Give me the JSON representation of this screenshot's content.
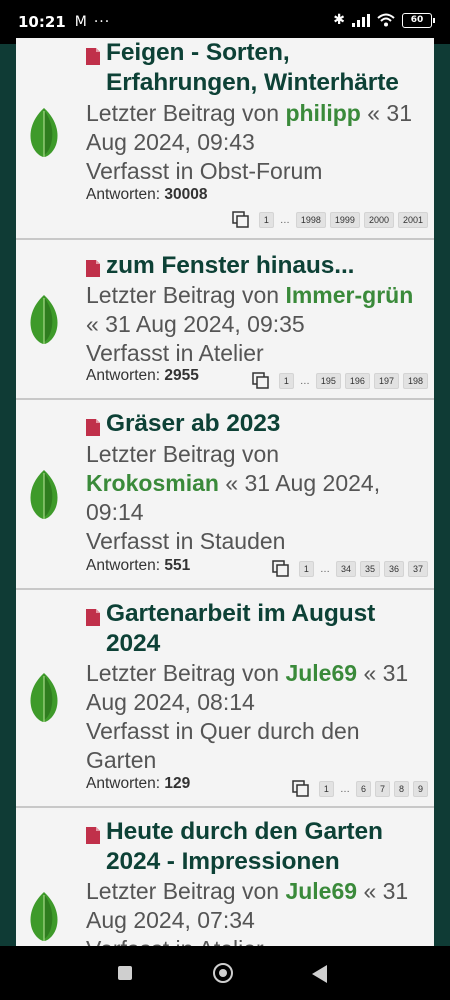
{
  "status": {
    "time": "10:21",
    "battery": "60"
  },
  "topics": [
    {
      "title_lines": [
        "Feigen - Sorten,",
        "Erfahrungen, Winterhärte"
      ],
      "last_prefix": "Letzter Beitrag von",
      "author": "philipp",
      "date_parts": [
        "« 31",
        "Aug 2024, 09:43"
      ],
      "forum_prefix": "Verfasst in",
      "forum_lines": [
        "Obst-Forum"
      ],
      "replies_label": "Antworten:",
      "replies": "30008",
      "pages": [
        "1",
        "1998",
        "1999",
        "2000",
        "2001"
      ]
    },
    {
      "title_lines": [
        "zum Fenster hinaus..."
      ],
      "last_prefix": "Letzter Beitrag von",
      "author": "Immer-grün",
      "date_parts": [
        "« 31 Aug 2024, 09:35"
      ],
      "forum_prefix": "Verfasst in",
      "forum_lines": [
        "Atelier"
      ],
      "replies_label": "Antworten:",
      "replies": "2955",
      "pages": [
        "1",
        "195",
        "196",
        "197",
        "198"
      ]
    },
    {
      "title_lines": [
        "Gräser ab 2023"
      ],
      "last_prefix": "Letzter Beitrag von",
      "author": "Krokosmian",
      "date_parts": [
        "« 31 Aug 2024,",
        "09:14"
      ],
      "forum_prefix": "Verfasst in",
      "forum_lines": [
        "Stauden"
      ],
      "replies_label": "Antworten:",
      "replies": "551",
      "pages": [
        "1",
        "34",
        "35",
        "36",
        "37"
      ]
    },
    {
      "title_lines": [
        "Gartenarbeit im August",
        "2024"
      ],
      "last_prefix": "Letzter Beitrag von",
      "author": "Jule69",
      "date_parts": [
        "« 31",
        "Aug 2024, 08:14"
      ],
      "forum_prefix": "Verfasst in",
      "forum_lines": [
        "Quer durch den",
        "Garten"
      ],
      "replies_label": "Antworten:",
      "replies": "129",
      "pages": [
        "1",
        "6",
        "7",
        "8",
        "9"
      ]
    },
    {
      "title_lines": [
        "Heute durch den Garten",
        "2024 - Impressionen"
      ],
      "last_prefix": "Letzter Beitrag von",
      "author": "Jule69",
      "date_parts": [
        "« 31",
        "Aug 2024, 07:34"
      ],
      "forum_prefix": "Verfasst in",
      "forum_lines": [
        "Atelier"
      ],
      "replies_label": "",
      "replies": "",
      "pages": []
    }
  ],
  "colors": {
    "title": "#0d4136",
    "author": "#3a8a3a",
    "topic_icon": "#c0304a",
    "frame": "#0f3b35"
  },
  "icons": {
    "leaf": "leaf-icon",
    "topic": "topic-unread-icon",
    "pages": "pages-icon"
  }
}
